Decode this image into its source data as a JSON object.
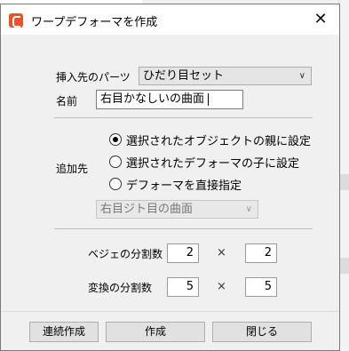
{
  "dialog": {
    "title": "ワープデフォーマを作成",
    "close_glyph": "✕"
  },
  "form": {
    "parts_label": "挿入先のパーツ",
    "parts_value": "ひだり目セット",
    "name_label": "名前",
    "name_value": "右目かなしいの曲面",
    "add_to_label": "追加先",
    "options": [
      {
        "label": "選択されたオブジェクトの親に設定",
        "checked": true
      },
      {
        "label": "選択されたデフォーマの子に設定",
        "checked": false
      },
      {
        "label": "デフォーマを直接指定",
        "checked": false
      }
    ],
    "deformer_value": "右目ジト目の曲面",
    "bezier_label": "ベジェの分割数",
    "bezier_x": "2",
    "bezier_y": "2",
    "convert_label": "変換の分割数",
    "convert_x": "5",
    "convert_y": "5",
    "times_glyph": "×"
  },
  "buttons": {
    "continuous": "連続作成",
    "create": "作成",
    "close": "閉じる"
  }
}
